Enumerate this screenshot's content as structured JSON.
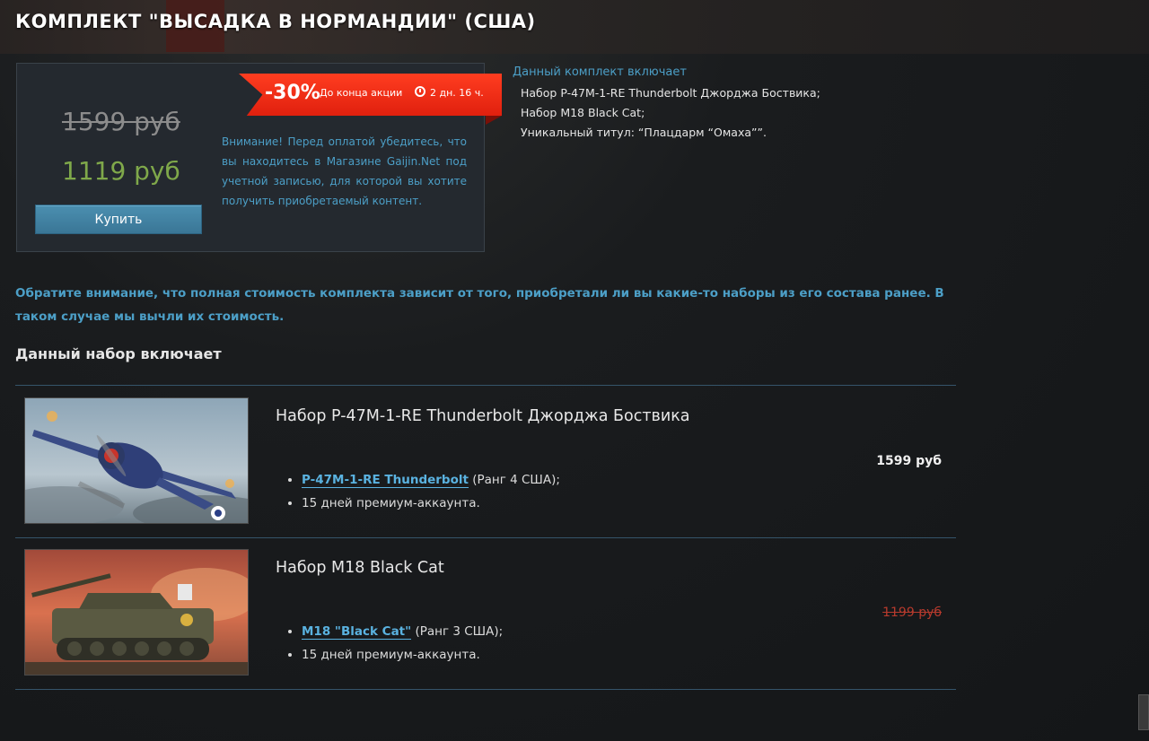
{
  "title": "КОМПЛЕКТ \"ВЫСАДКА В НОРМАНДИИ\" (США)",
  "price_box": {
    "old_price": "1599 руб",
    "new_price": "1119 руб",
    "buy_label": "Купить",
    "warning": "Внимание! Перед оплатой убедитесь, что вы находитесь в Магазине Gaijin.Net под учетной записью, для которой вы хотите получить приобретаемый контент."
  },
  "promo": {
    "discount": "-30%",
    "timer_label": "До конца акции",
    "timer_value": "2 дн. 16 ч."
  },
  "bundle_includes": {
    "heading": "Данный комплект включает",
    "items": [
      "Набор P-47M-1-RE Thunderbolt Джорджа Боствика;",
      "Набор M18 Black Cat;",
      "Уникальный титул: “Плацдарм “Омаха””."
    ]
  },
  "notice": "Обратите внимание, что полная стоимость комплекта зависит от того, приобретали ли вы какие-то наборы из его состава ранее. В таком случае мы вычли их стоимость.",
  "section_title": "Данный набор включает",
  "packs": [
    {
      "name": "Набор P-47M-1-RE Thunderbolt Джорджа Боствика",
      "vehicle_link": "P-47M-1-RE Thunderbolt",
      "vehicle_rank": " (Ранг 4 США);",
      "premium": "15 дней премиум-аккаунта.",
      "price": "1599 руб"
    },
    {
      "name": "Набор M18 Black Cat",
      "vehicle_link": "M18 \"Black Cat\"",
      "vehicle_rank": " (Ранг 3 США);",
      "premium": "15 дней премиум-аккаунта.",
      "price": "1199 руб"
    }
  ],
  "colors": {
    "accent_blue": "#4c9fc7",
    "discount_red": "#e0200e",
    "new_price_green": "#7fa84a",
    "struck_price_red": "#b63a2d"
  }
}
